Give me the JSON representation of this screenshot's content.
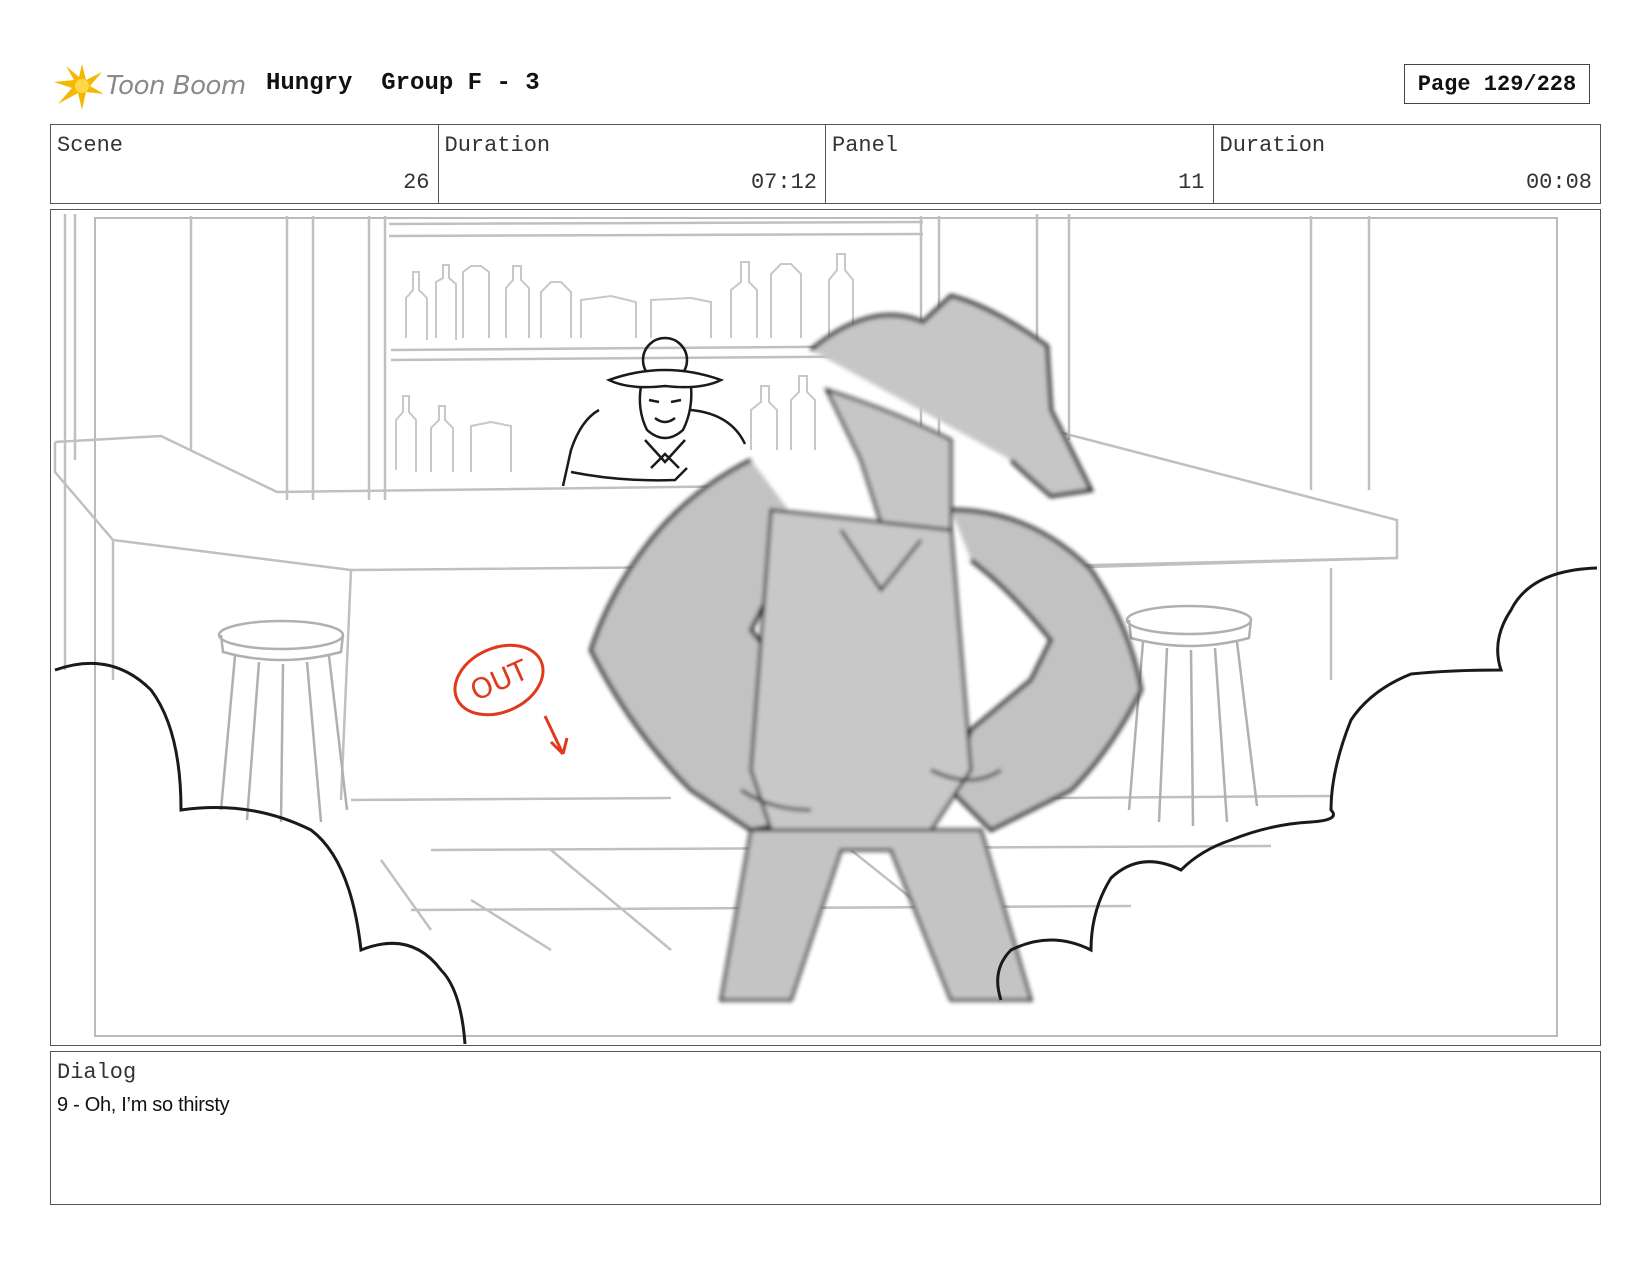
{
  "header": {
    "logo_text": "Toon Boom",
    "project": "Hungry",
    "group": "Group F - 3",
    "page": "Page 129/228"
  },
  "info": {
    "scene_label": "Scene",
    "scene_value": "26",
    "scene_duration_label": "Duration",
    "scene_duration_value": "07:12",
    "panel_label": "Panel",
    "panel_value": "11",
    "panel_duration_label": "Duration",
    "panel_duration_value": "00:08"
  },
  "panel_annotation": {
    "text": "OUT",
    "color": "#e03a1e"
  },
  "dialog": {
    "label": "Dialog",
    "text": "9 - Oh, I’m so thirsty"
  },
  "colors": {
    "logo_accent": "#f5b800",
    "sketch_light": "#b8b8b8",
    "figure_fill": "#c4c4c4",
    "ink": "#1a1a1a"
  }
}
